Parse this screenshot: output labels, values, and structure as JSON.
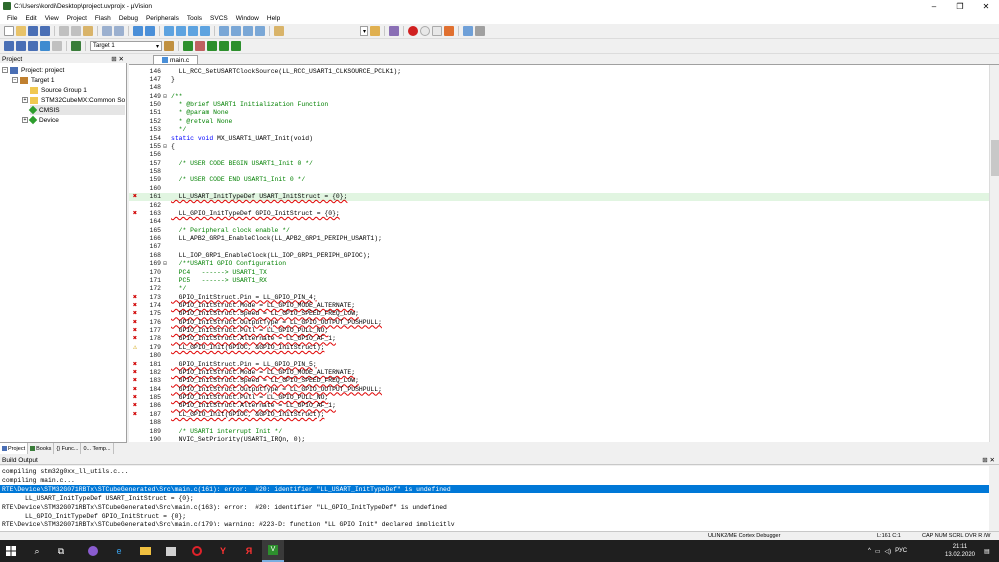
{
  "title": "C:\\Users\\kordi\\Desktop\\project.uvprojx - µVision",
  "menu": [
    "File",
    "Edit",
    "View",
    "Project",
    "Flash",
    "Debug",
    "Peripherals",
    "Tools",
    "SVCS",
    "Window",
    "Help"
  ],
  "target_select": "Target 1",
  "project_panel": {
    "title": "Project",
    "root": "Project: project",
    "target": "Target 1",
    "items": [
      "Source Group 1",
      "STM32CubeMX:Common So",
      "CMSIS",
      "Device"
    ],
    "tabs": [
      "Project",
      "Books",
      "{} Func...",
      "0... Temp..."
    ]
  },
  "editor": {
    "tab": "main.c",
    "lines": [
      {
        "n": "146",
        "t": "  LL_RCC_SetUSARTClockSource(LL_RCC_USART1_CLKSOURCE_PCLK1);",
        "k": "n",
        "m": "",
        "f": ""
      },
      {
        "n": "147",
        "t": "}",
        "k": "n",
        "m": "",
        "f": ""
      },
      {
        "n": "148",
        "t": "",
        "k": "n",
        "m": "",
        "f": ""
      },
      {
        "n": "149",
        "t": "/**",
        "k": "c",
        "m": "",
        "f": "⊟"
      },
      {
        "n": "150",
        "t": "  * @brief USART1 Initialization Function",
        "k": "c",
        "m": "",
        "f": ""
      },
      {
        "n": "151",
        "t": "  * @param None",
        "k": "c",
        "m": "",
        "f": ""
      },
      {
        "n": "152",
        "t": "  * @retval None",
        "k": "c",
        "m": "",
        "f": ""
      },
      {
        "n": "153",
        "t": "  */",
        "k": "c",
        "m": "",
        "f": ""
      },
      {
        "n": "154",
        "t": "static void MX_USART1_UART_Init(void)",
        "k": "s",
        "m": "",
        "f": ""
      },
      {
        "n": "155",
        "t": "{",
        "k": "n",
        "m": "",
        "f": "⊟"
      },
      {
        "n": "156",
        "t": "",
        "k": "n",
        "m": "",
        "f": ""
      },
      {
        "n": "157",
        "t": "  /* USER CODE BEGIN USART1_Init 0 */",
        "k": "c",
        "m": "",
        "f": ""
      },
      {
        "n": "158",
        "t": "",
        "k": "n",
        "m": "",
        "f": ""
      },
      {
        "n": "159",
        "t": "  /* USER CODE END USART1_Init 0 */",
        "k": "c",
        "m": "",
        "f": ""
      },
      {
        "n": "160",
        "t": "",
        "k": "n",
        "m": "",
        "f": ""
      },
      {
        "n": "161",
        "t": "  LL_USART_InitTypeDef USART_InitStruct = {0};",
        "k": "e",
        "m": "✖",
        "f": "",
        "hl": true
      },
      {
        "n": "162",
        "t": "",
        "k": "n",
        "m": "",
        "f": ""
      },
      {
        "n": "163",
        "t": "  LL_GPIO_InitTypeDef GPIO_InitStruct = {0};",
        "k": "e",
        "m": "✖",
        "f": ""
      },
      {
        "n": "164",
        "t": "",
        "k": "n",
        "m": "",
        "f": ""
      },
      {
        "n": "165",
        "t": "  /* Peripheral clock enable */",
        "k": "c",
        "m": "",
        "f": ""
      },
      {
        "n": "166",
        "t": "  LL_APB2_GRP1_EnableClock(LL_APB2_GRP1_PERIPH_USART1);",
        "k": "n",
        "m": "",
        "f": ""
      },
      {
        "n": "167",
        "t": "",
        "k": "n",
        "m": "",
        "f": ""
      },
      {
        "n": "168",
        "t": "  LL_IOP_GRP1_EnableClock(LL_IOP_GRP1_PERIPH_GPIOC);",
        "k": "n",
        "m": "",
        "f": ""
      },
      {
        "n": "169",
        "t": "  /**USART1 GPIO Configuration",
        "k": "c",
        "m": "",
        "f": "⊟"
      },
      {
        "n": "170",
        "t": "  PC4   ------> USART1_TX",
        "k": "c",
        "m": "",
        "f": ""
      },
      {
        "n": "171",
        "t": "  PC5   ------> USART1_RX",
        "k": "c",
        "m": "",
        "f": ""
      },
      {
        "n": "172",
        "t": "  */",
        "k": "c",
        "m": "",
        "f": ""
      },
      {
        "n": "173",
        "t": "  GPIO_InitStruct.Pin = LL_GPIO_PIN_4;",
        "k": "e",
        "m": "✖",
        "f": ""
      },
      {
        "n": "174",
        "t": "  GPIO_InitStruct.Mode = LL_GPIO_MODE_ALTERNATE;",
        "k": "e",
        "m": "✖",
        "f": ""
      },
      {
        "n": "175",
        "t": "  GPIO_InitStruct.Speed = LL_GPIO_SPEED_FREQ_LOW;",
        "k": "e",
        "m": "✖",
        "f": ""
      },
      {
        "n": "176",
        "t": "  GPIO_InitStruct.OutputType = LL_GPIO_OUTPUT_PUSHPULL;",
        "k": "e",
        "m": "✖",
        "f": ""
      },
      {
        "n": "177",
        "t": "  GPIO_InitStruct.Pull = LL_GPIO_PULL_NO;",
        "k": "e",
        "m": "✖",
        "f": ""
      },
      {
        "n": "178",
        "t": "  GPIO_InitStruct.Alternate = LL_GPIO_AF_1;",
        "k": "e",
        "m": "✖",
        "f": ""
      },
      {
        "n": "179",
        "t": "  LL_GPIO_Init(GPIOC, &GPIO_InitStruct);",
        "k": "e",
        "m": "⚠",
        "f": ""
      },
      {
        "n": "180",
        "t": "",
        "k": "n",
        "m": "",
        "f": ""
      },
      {
        "n": "181",
        "t": "  GPIO_InitStruct.Pin = LL_GPIO_PIN_5;",
        "k": "e",
        "m": "✖",
        "f": ""
      },
      {
        "n": "182",
        "t": "  GPIO_InitStruct.Mode = LL_GPIO_MODE_ALTERNATE;",
        "k": "e",
        "m": "✖",
        "f": ""
      },
      {
        "n": "183",
        "t": "  GPIO_InitStruct.Speed = LL_GPIO_SPEED_FREQ_LOW;",
        "k": "e",
        "m": "✖",
        "f": ""
      },
      {
        "n": "184",
        "t": "  GPIO_InitStruct.OutputType = LL_GPIO_OUTPUT_PUSHPULL;",
        "k": "e",
        "m": "✖",
        "f": ""
      },
      {
        "n": "185",
        "t": "  GPIO_InitStruct.Pull = LL_GPIO_PULL_NO;",
        "k": "e",
        "m": "✖",
        "f": ""
      },
      {
        "n": "186",
        "t": "  GPIO_InitStruct.Alternate = LL_GPIO_AF_1;",
        "k": "e",
        "m": "✖",
        "f": ""
      },
      {
        "n": "187",
        "t": "  LL_GPIO_Init(GPIOC, &GPIO_InitStruct);",
        "k": "e",
        "m": "✖",
        "f": ""
      },
      {
        "n": "188",
        "t": "",
        "k": "n",
        "m": "",
        "f": ""
      },
      {
        "n": "189",
        "t": "  /* USART1 interrupt Init */",
        "k": "c",
        "m": "",
        "f": ""
      },
      {
        "n": "190",
        "t": "  NVIC_SetPriority(USART1_IRQn, 0);",
        "k": "n",
        "m": "",
        "f": ""
      }
    ]
  },
  "build_output": {
    "title": "Build Output",
    "lines": [
      "compiling stm32g0xx_ll_utils.c...",
      "compiling main.c...",
      "RTE\\Device\\STM32G071RBTx\\STCubeGenerated\\Src\\main.c(161): error:  #20: identifier \"LL_USART_InitTypeDef\" is undefined",
      "      LL_USART_InitTypeDef USART_InitStruct = {0};",
      "RTE\\Device\\STM32G071RBTx\\STCubeGenerated\\Src\\main.c(163): error:  #20: identifier \"LL_GPIO_InitTypeDef\" is undefined",
      "      LL_GPIO_InitTypeDef GPIO_InitStruct = {0};",
      "RTE\\Device\\STM32G071RBTx\\STCubeGenerated\\Src\\main.c(179): warning: #223-D: function \"LL_GPIO_Init\" declared implicitly"
    ]
  },
  "status": {
    "debugger": "ULINK2/ME Cortex Debugger",
    "position": "L:161 C:1",
    "flags": "CAP  NUM  SCRL  OVR  R /W"
  },
  "taskbar": {
    "lang": "РУС",
    "time": "21:11",
    "date": "13.02.2020"
  },
  "colors": {
    "error": "#d00000",
    "selection": "#0078d7",
    "comment": "#008000",
    "keyword": "#0000ff"
  }
}
